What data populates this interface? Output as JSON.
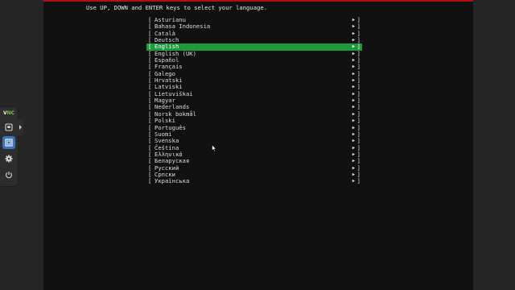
{
  "installer": {
    "instruction": "Use UP, DOWN and ENTER keys to select your language.",
    "bracket_left": "[",
    "bracket_right": "]",
    "arrow": "▶",
    "selected_language": "English",
    "languages": [
      "Asturianu",
      "Bahasa Indonesia",
      "Català",
      "Deutsch",
      "English",
      "English (UK)",
      "Español",
      "Français",
      "Galego",
      "Hrvatski",
      "Latviski",
      "Lietuviškai",
      "Magyar",
      "Nederlands",
      "Norsk bokmål",
      "Polski",
      "Português",
      "Suomi",
      "Svenska",
      "Čeština",
      "Ελληνικά",
      "Беларуская",
      "Русский",
      "Српски",
      "Українська"
    ]
  },
  "vnc_sidebar": {
    "logo_v": "V",
    "logo_nc": "NC",
    "buttons": [
      {
        "icon": "display-icon",
        "active": false
      },
      {
        "icon": "fullscreen-icon",
        "active": true
      },
      {
        "icon": "settings-gear-icon",
        "active": false
      },
      {
        "icon": "power-icon",
        "active": false
      }
    ]
  },
  "colors": {
    "selection": "#1e9a3b",
    "console_bg": "#111111",
    "page_bg": "#262626",
    "top_bar": "#b01010",
    "vnc_active": "#3a73b8"
  }
}
